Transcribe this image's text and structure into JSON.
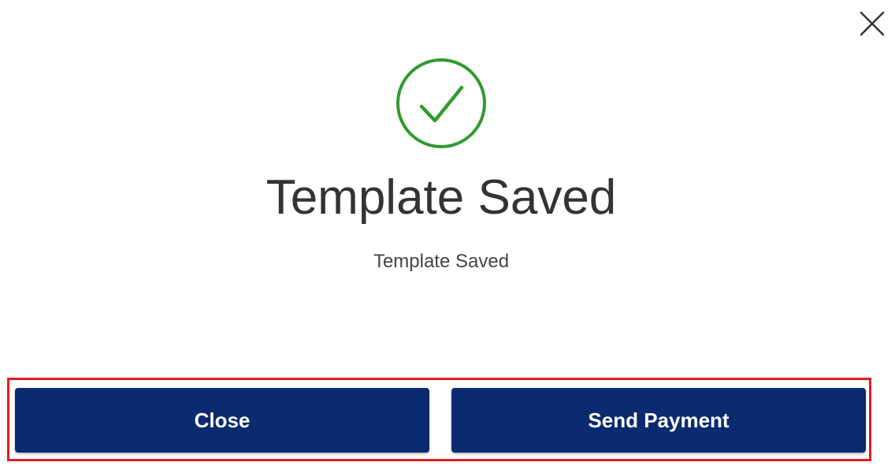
{
  "dialog": {
    "close_icon": "close-x-icon",
    "status_icon": "check-circle-icon",
    "title": "Template Saved",
    "message": "Template Saved",
    "buttons": {
      "close_label": "Close",
      "send_payment_label": "Send Payment"
    }
  },
  "colors": {
    "success": "#2e9b2e",
    "primary_button": "#0b2a6f",
    "button_text": "#ffffff",
    "title_text": "#333333",
    "highlight": "#e31b23"
  }
}
